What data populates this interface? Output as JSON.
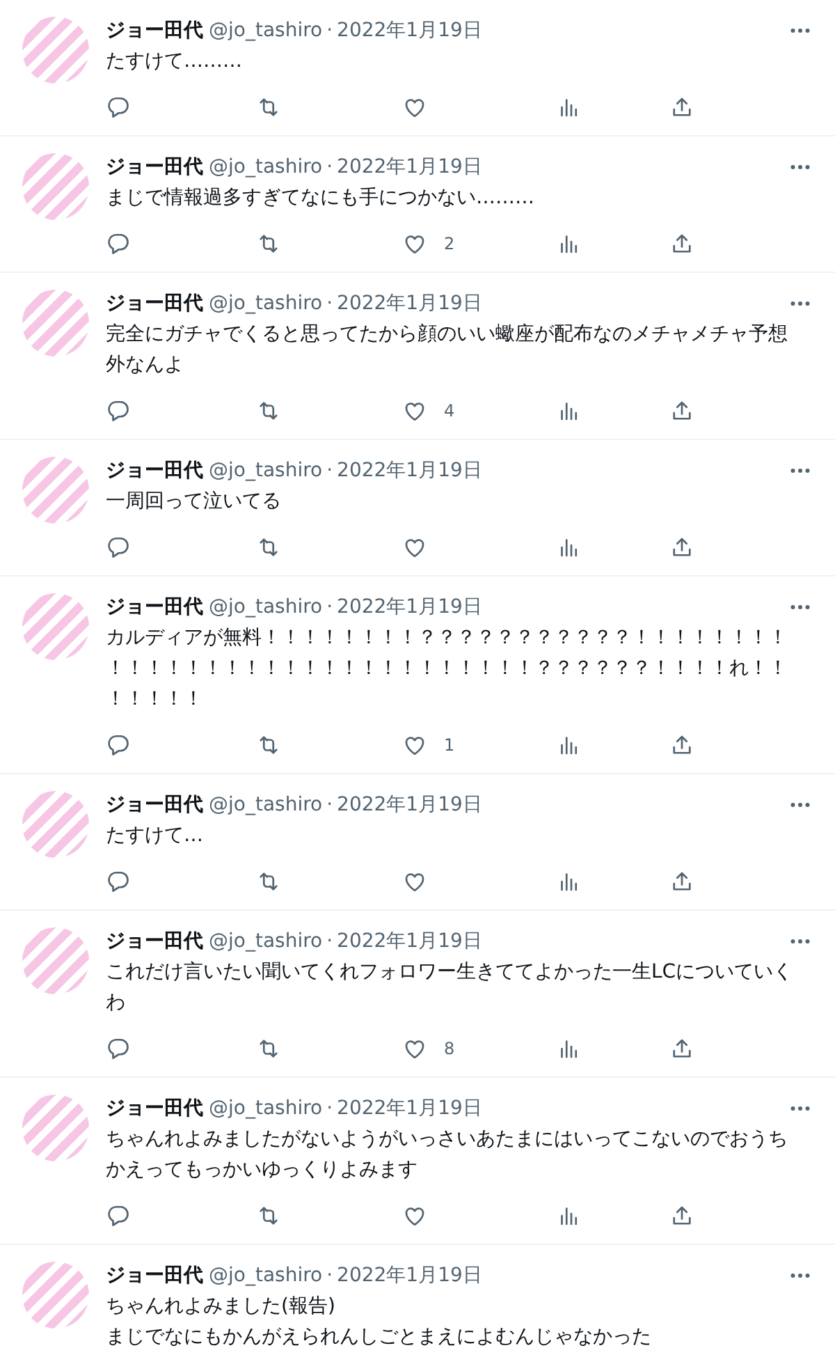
{
  "tweets": [
    {
      "name": "ジョー田代",
      "handle": "@jo_tashiro",
      "separator": "·",
      "date": "2022年1月19日",
      "text": "たすけて………"
    },
    {
      "name": "ジョー田代",
      "handle": "@jo_tashiro",
      "separator": "·",
      "date": "2022年1月19日",
      "text": "まじで情報過多すぎてなにも手につかない………",
      "like_count": "2"
    },
    {
      "name": "ジョー田代",
      "handle": "@jo_tashiro",
      "separator": "·",
      "date": "2022年1月19日",
      "text": "完全にガチャでくると思ってたから顔のいい蠍座が配布なのメチャメチャ予想外なんよ",
      "like_count": "4"
    },
    {
      "name": "ジョー田代",
      "handle": "@jo_tashiro",
      "separator": "·",
      "date": "2022年1月19日",
      "text": "一周回って泣いてる"
    },
    {
      "name": "ジョー田代",
      "handle": "@jo_tashiro",
      "separator": "·",
      "date": "2022年1月19日",
      "text": "カルディアが無料！！！！！！！！？？？？？？？？？？？！！！！！！！！！！！！！！！！！！！！！！！！！！！！！！？？？？？？！！！！れ！！！！！！！",
      "like_count": "1"
    },
    {
      "name": "ジョー田代",
      "handle": "@jo_tashiro",
      "separator": "·",
      "date": "2022年1月19日",
      "text": "たすけて…"
    },
    {
      "name": "ジョー田代",
      "handle": "@jo_tashiro",
      "separator": "·",
      "date": "2022年1月19日",
      "text": "これだけ言いたい聞いてくれフォロワー生きててよかった一生LCについていくわ",
      "like_count": "8"
    },
    {
      "name": "ジョー田代",
      "handle": "@jo_tashiro",
      "separator": "·",
      "date": "2022年1月19日",
      "text": "ちゃんれよみましたがないようがいっさいあたまにはいってこないのでおうちかえってもっかいゆっくりよみます"
    },
    {
      "name": "ジョー田代",
      "handle": "@jo_tashiro",
      "separator": "·",
      "date": "2022年1月19日",
      "text": "ちゃんれよみました(報告)\nまじでなにもかんがえられんしごとまえによむんじゃなかった"
    }
  ]
}
